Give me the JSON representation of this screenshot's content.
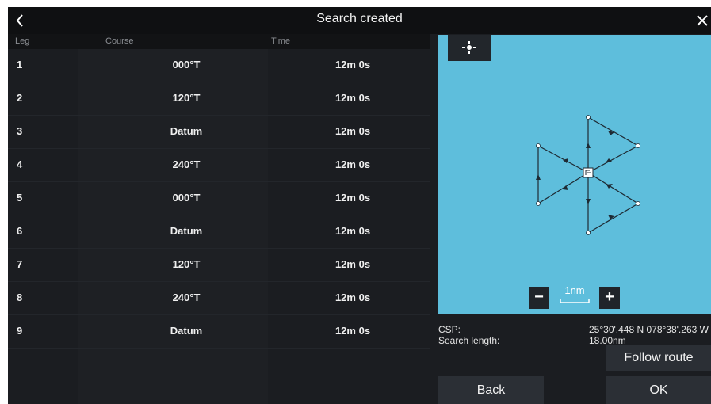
{
  "header": {
    "title": "Search created",
    "back_icon": "chevron-left-icon",
    "close_icon": "close-icon"
  },
  "table": {
    "columns": [
      "Leg",
      "Course",
      "Time"
    ],
    "rows": [
      {
        "leg": "1",
        "course": "000°T",
        "time": "12m  0s"
      },
      {
        "leg": "2",
        "course": "120°T",
        "time": "12m  0s"
      },
      {
        "leg": "3",
        "course": "Datum",
        "time": "12m  0s"
      },
      {
        "leg": "4",
        "course": "240°T",
        "time": "12m  0s"
      },
      {
        "leg": "5",
        "course": "000°T",
        "time": "12m  0s"
      },
      {
        "leg": "6",
        "course": "Datum",
        "time": "12m  0s"
      },
      {
        "leg": "7",
        "course": "120°T",
        "time": "12m  0s"
      },
      {
        "leg": "8",
        "course": "240°T",
        "time": "12m  0s"
      },
      {
        "leg": "9",
        "course": "Datum",
        "time": "12m  0s"
      }
    ]
  },
  "map": {
    "background_color": "#5ebedc",
    "recenter_icon": "crosshair-icon",
    "zoom_out_label": "−",
    "zoom_in_label": "+",
    "scale_label": "1nm"
  },
  "info": {
    "csp_label": "CSP:",
    "csp_value": "25°30'.448 N  078°38'.263 W",
    "length_label": "Search length:",
    "length_value": "18.00nm"
  },
  "actions": {
    "follow_route": "Follow route",
    "back": "Back",
    "ok": "OK"
  }
}
